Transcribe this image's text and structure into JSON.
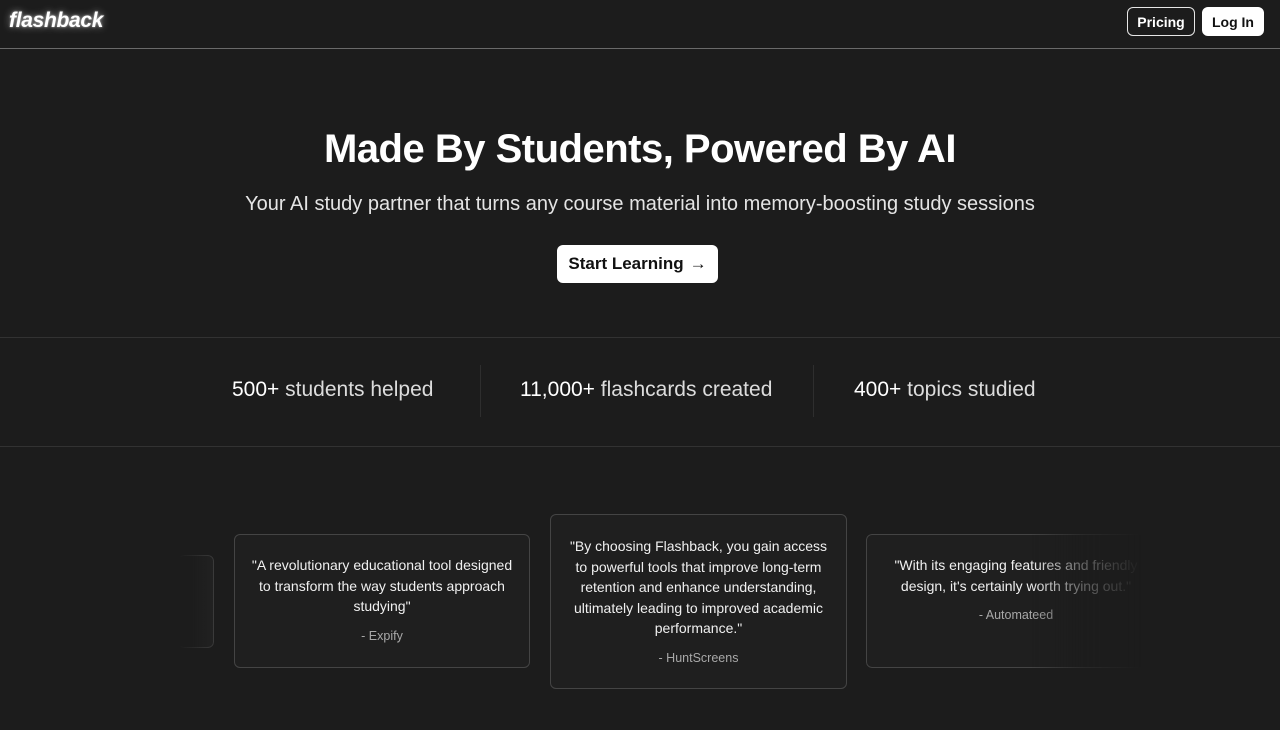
{
  "nav": {
    "logo": "flashback",
    "pricing_label": "Pricing",
    "login_label": "Log In"
  },
  "hero": {
    "title": "Made By Students, Powered By AI",
    "subtitle": "Your AI study partner that turns any course material into memory-boosting study sessions",
    "cta_label": "Start Learning",
    "cta_icon": "arrow-right-icon"
  },
  "stats": [
    {
      "value": "500+",
      "label": "students helped"
    },
    {
      "value": "11,000+",
      "label": "flashcards created"
    },
    {
      "value": "400+",
      "label": "topics studied"
    }
  ],
  "testimonials": [
    {
      "quote": "\"A revolutionary educational tool designed to transform the way students approach studying\"",
      "author": "- Expify"
    },
    {
      "quote": "\"By choosing Flashback, you gain access to powerful tools that improve long-term retention and enhance understanding, ultimately leading to improved academic performance.\"",
      "author": "- HuntScreens"
    },
    {
      "quote": "\"With its engaging features and friendly design, it's certainly worth trying out.\"",
      "author": "- Automateed"
    }
  ],
  "colors": {
    "background": "#1c1c1c",
    "text": "#ffffff",
    "button_bg": "#ffffff",
    "button_text": "#111111",
    "card_border": "#444444"
  }
}
